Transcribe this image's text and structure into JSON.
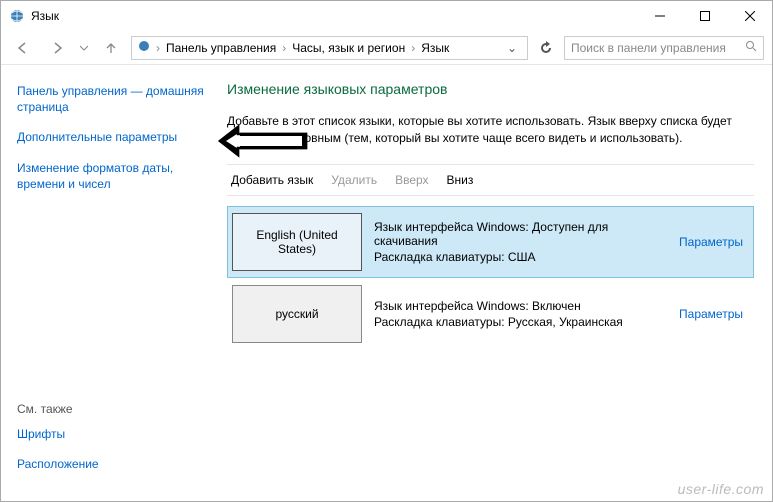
{
  "window": {
    "title": "Язык"
  },
  "breadcrumbs": {
    "root": "Панель управления",
    "mid": "Часы, язык и регион",
    "leaf": "Язык"
  },
  "search": {
    "placeholder": "Поиск в панели управления"
  },
  "sidebar": {
    "items": [
      "Панель управления — домашняя страница",
      "Дополнительные параметры",
      "Изменение форматов даты, времени и чисел"
    ],
    "seeAlso": "См. также",
    "extra": [
      "Шрифты",
      "Расположение"
    ]
  },
  "main": {
    "heading": "Изменение языковых параметров",
    "description": "Добавьте в этот список языки, которые вы хотите использовать. Язык вверху списка будет считаться основным (тем, который вы хотите чаще всего видеть и использовать).",
    "actions": {
      "add": "Добавить язык",
      "remove": "Удалить",
      "up": "Вверх",
      "down": "Вниз"
    },
    "optionsLabel": "Параметры",
    "langs": [
      {
        "name": "English (United States)",
        "line1": "Язык интерфейса Windows: Доступен для скачивания",
        "line2": "Раскладка клавиатуры: США",
        "selected": true
      },
      {
        "name": "русский",
        "line1": "Язык интерфейса Windows: Включен",
        "line2": "Раскладка клавиатуры: Русская, Украинская",
        "selected": false
      }
    ]
  },
  "watermark": "user-life.com"
}
